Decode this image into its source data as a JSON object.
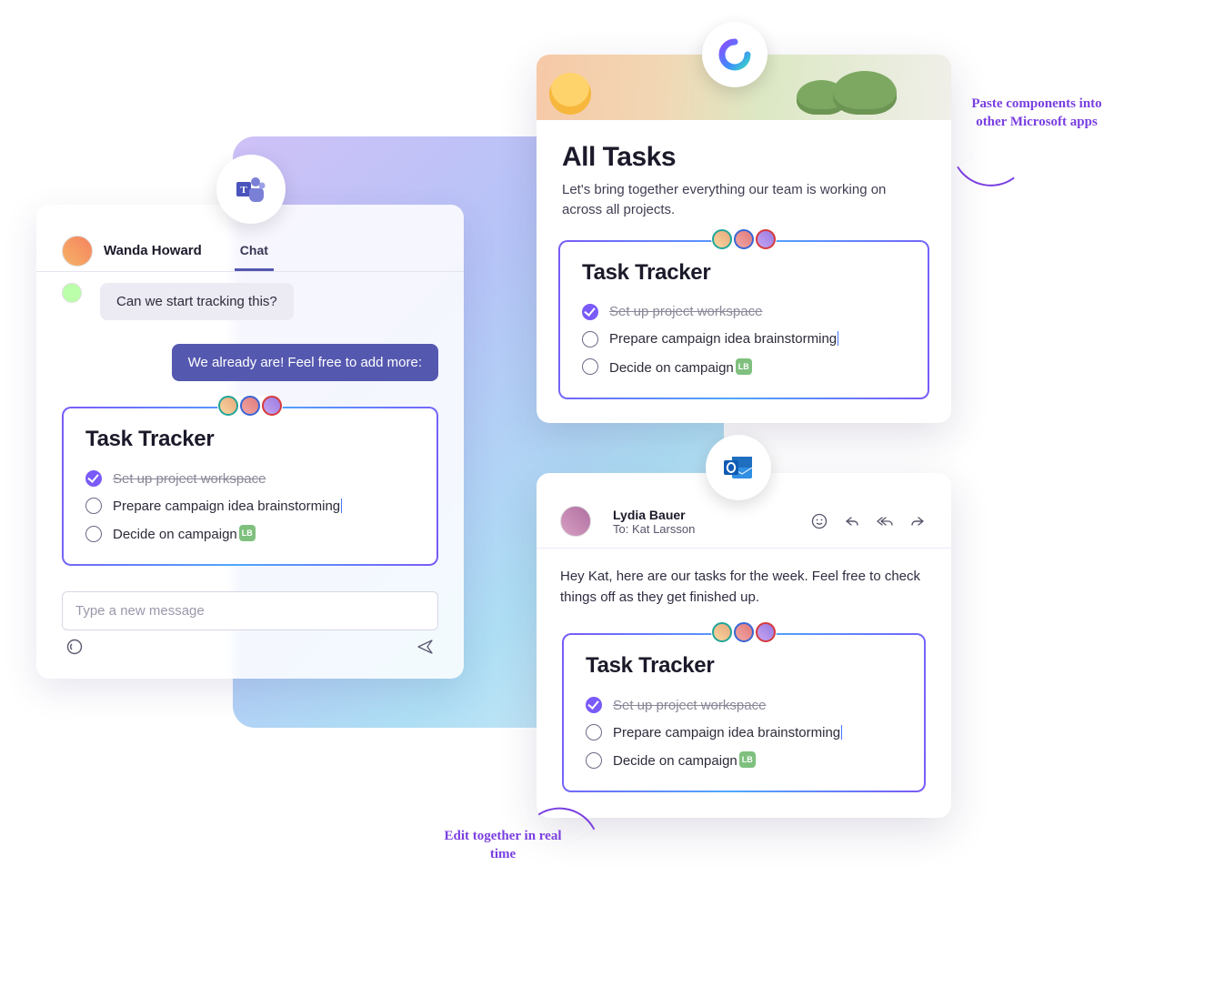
{
  "teams": {
    "contact_name": "Wanda Howard",
    "tab_label": "Chat",
    "msg_received": "Can we start tracking this?",
    "msg_sent": "We already are! Feel free to add more:",
    "input_placeholder": "Type a new message"
  },
  "loop": {
    "title": "All Tasks",
    "description": "Let's bring together everything our team is working on across all projects."
  },
  "outlook": {
    "from_name": "Lydia Bauer",
    "to_line": "To: Kat Larsson",
    "body": "Hey Kat, here are our tasks for the week. Feel free to check things off as they get finished up."
  },
  "tracker": {
    "title": "Task Tracker",
    "tasks": [
      {
        "label": "Set up project workspace",
        "done": true
      },
      {
        "label": "Prepare campaign idea brainstorming",
        "done": false,
        "caret": true
      },
      {
        "label": "Decide on campaign",
        "done": false,
        "badge": "LB"
      }
    ]
  },
  "annotations": {
    "paste": "Paste components into other Microsoft apps",
    "edit": "Edit together in real time"
  }
}
